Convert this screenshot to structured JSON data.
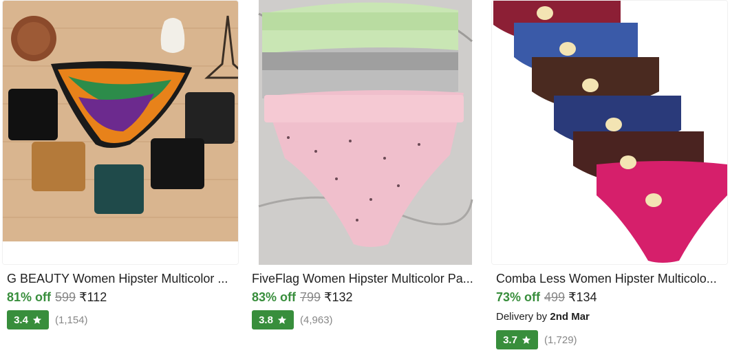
{
  "products": [
    {
      "title": "G BEAUTY Women Hipster Multicolor ...",
      "discount": "81% off",
      "mrp": "599",
      "price": "₹112",
      "rating": "3.4",
      "rating_count": "(1,154)"
    },
    {
      "title": "FiveFlag Women Hipster Multicolor Pa...",
      "discount": "83% off",
      "mrp": "799",
      "price": "₹132",
      "rating": "3.8",
      "rating_count": "(4,963)"
    },
    {
      "title": "Comba Less Women Hipster Multicolo...",
      "discount": "73% off",
      "mrp": "499",
      "price": "₹134",
      "delivery_prefix": "Delivery by",
      "delivery_date": "2nd Mar",
      "rating": "3.7",
      "rating_count": "(1,729)"
    }
  ],
  "colors": {
    "discount_green": "#388e3c",
    "rating_badge": "#388e3c",
    "muted_text": "#878787"
  },
  "icons": {
    "rating_star": "star-icon"
  }
}
